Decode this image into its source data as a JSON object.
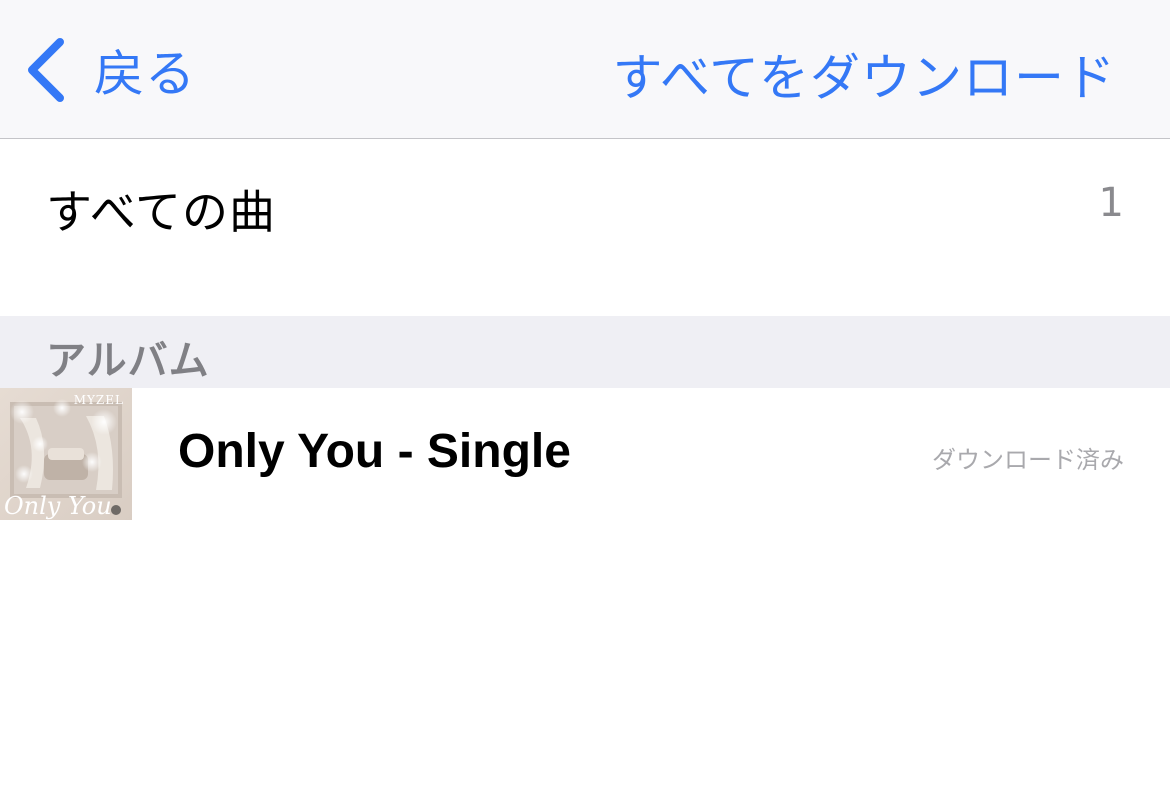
{
  "navbar": {
    "back_label": "戻る",
    "download_all_label": "すべてをダウンロード",
    "accent_color": "#3478f6"
  },
  "all_songs": {
    "label": "すべての曲",
    "count": "1"
  },
  "sections": {
    "albums_title": "アルバム"
  },
  "albums": [
    {
      "title": "Only You - Single",
      "status": "ダウンロード済み",
      "artwork": {
        "artist_text": "MYZEL",
        "title_text": "Only You"
      }
    }
  ]
}
